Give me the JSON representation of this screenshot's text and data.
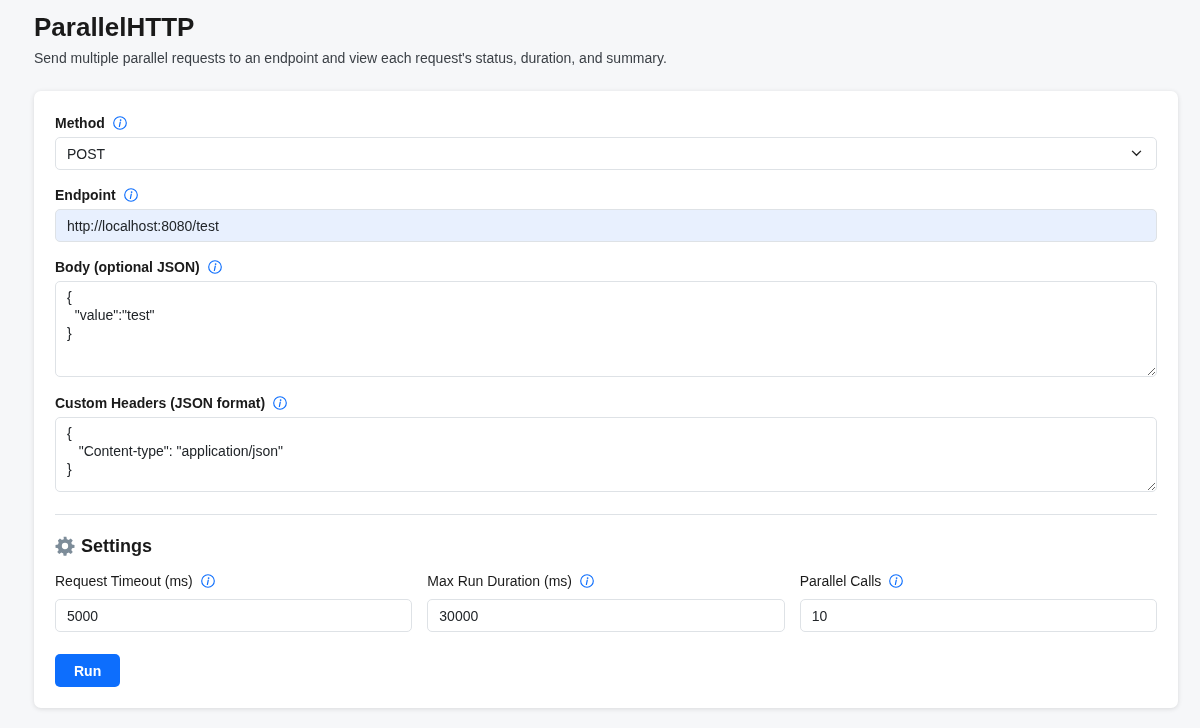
{
  "page": {
    "title": "ParallelHTTP",
    "subtitle": "Send multiple parallel requests to an endpoint and view each request's status, duration, and summary."
  },
  "form": {
    "fields": [
      {
        "kind": "select",
        "label": "Method",
        "value": "POST"
      },
      {
        "kind": "input",
        "label": "Endpoint",
        "value": "http://localhost:8080/test",
        "autofilled": true
      },
      {
        "kind": "textarea",
        "label": "Body (optional JSON)",
        "value": "{\n  \"value\":\"test\"\n}"
      },
      {
        "kind": "textarea",
        "label": "Custom Headers (JSON format)",
        "value": "{\n   \"Content-type\": \"application/json\"\n}"
      }
    ]
  },
  "settings": {
    "title": "Settings",
    "fields": [
      {
        "label": "Request Timeout (ms)",
        "value": "5000"
      },
      {
        "label": "Max Run Duration (ms)",
        "value": "30000"
      },
      {
        "label": "Parallel Calls",
        "value": "10"
      }
    ]
  },
  "buttons": [
    {
      "label": "Run"
    }
  ]
}
